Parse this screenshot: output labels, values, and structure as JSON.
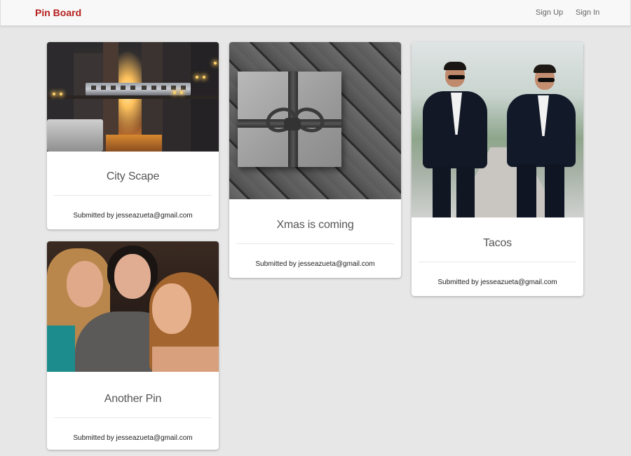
{
  "navbar": {
    "brand": "Pin Board",
    "links": [
      {
        "label": "Sign Up"
      },
      {
        "label": "Sign In"
      }
    ]
  },
  "pins": [
    {
      "title": "City Scape",
      "submitted_by": "Submitted by jesseazueta@gmail.com"
    },
    {
      "title": "Xmas is coming",
      "submitted_by": "Submitted by jesseazueta@gmail.com"
    },
    {
      "title": "Tacos",
      "submitted_by": "Submitted by jesseazueta@gmail.com"
    },
    {
      "title": "Another Pin",
      "submitted_by": "Submitted by jesseazueta@gmail.com"
    }
  ],
  "colors": {
    "brand": "#b6211f",
    "page_background": "#e7e7e7",
    "navbar_background": "#f8f8f8"
  }
}
